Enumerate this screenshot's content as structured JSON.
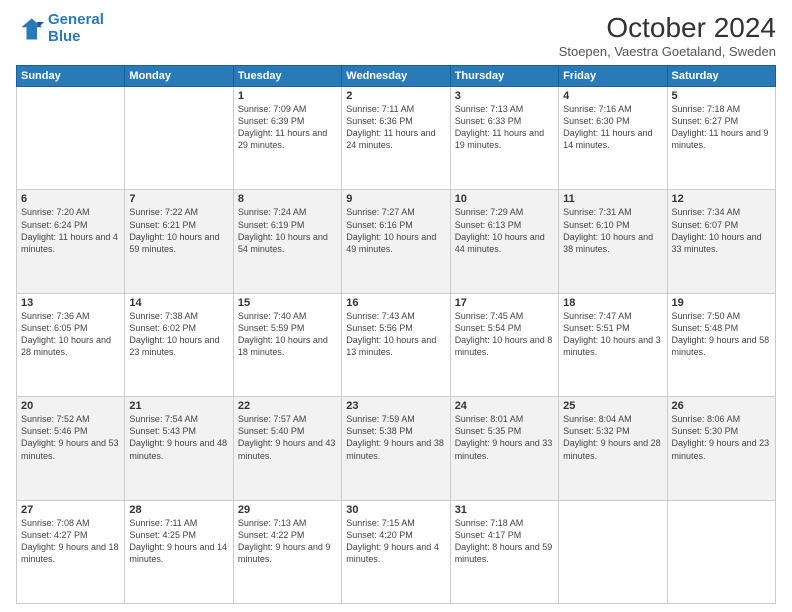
{
  "logo": {
    "line1": "General",
    "line2": "Blue"
  },
  "title": "October 2024",
  "location": "Stoepen, Vaestra Goetaland, Sweden",
  "days_header": [
    "Sunday",
    "Monday",
    "Tuesday",
    "Wednesday",
    "Thursday",
    "Friday",
    "Saturday"
  ],
  "weeks": [
    [
      {
        "day": "",
        "info": ""
      },
      {
        "day": "",
        "info": ""
      },
      {
        "day": "1",
        "info": "Sunrise: 7:09 AM\nSunset: 6:39 PM\nDaylight: 11 hours and 29 minutes."
      },
      {
        "day": "2",
        "info": "Sunrise: 7:11 AM\nSunset: 6:36 PM\nDaylight: 11 hours and 24 minutes."
      },
      {
        "day": "3",
        "info": "Sunrise: 7:13 AM\nSunset: 6:33 PM\nDaylight: 11 hours and 19 minutes."
      },
      {
        "day": "4",
        "info": "Sunrise: 7:16 AM\nSunset: 6:30 PM\nDaylight: 11 hours and 14 minutes."
      },
      {
        "day": "5",
        "info": "Sunrise: 7:18 AM\nSunset: 6:27 PM\nDaylight: 11 hours and 9 minutes."
      }
    ],
    [
      {
        "day": "6",
        "info": "Sunrise: 7:20 AM\nSunset: 6:24 PM\nDaylight: 11 hours and 4 minutes."
      },
      {
        "day": "7",
        "info": "Sunrise: 7:22 AM\nSunset: 6:21 PM\nDaylight: 10 hours and 59 minutes."
      },
      {
        "day": "8",
        "info": "Sunrise: 7:24 AM\nSunset: 6:19 PM\nDaylight: 10 hours and 54 minutes."
      },
      {
        "day": "9",
        "info": "Sunrise: 7:27 AM\nSunset: 6:16 PM\nDaylight: 10 hours and 49 minutes."
      },
      {
        "day": "10",
        "info": "Sunrise: 7:29 AM\nSunset: 6:13 PM\nDaylight: 10 hours and 44 minutes."
      },
      {
        "day": "11",
        "info": "Sunrise: 7:31 AM\nSunset: 6:10 PM\nDaylight: 10 hours and 38 minutes."
      },
      {
        "day": "12",
        "info": "Sunrise: 7:34 AM\nSunset: 6:07 PM\nDaylight: 10 hours and 33 minutes."
      }
    ],
    [
      {
        "day": "13",
        "info": "Sunrise: 7:36 AM\nSunset: 6:05 PM\nDaylight: 10 hours and 28 minutes."
      },
      {
        "day": "14",
        "info": "Sunrise: 7:38 AM\nSunset: 6:02 PM\nDaylight: 10 hours and 23 minutes."
      },
      {
        "day": "15",
        "info": "Sunrise: 7:40 AM\nSunset: 5:59 PM\nDaylight: 10 hours and 18 minutes."
      },
      {
        "day": "16",
        "info": "Sunrise: 7:43 AM\nSunset: 5:56 PM\nDaylight: 10 hours and 13 minutes."
      },
      {
        "day": "17",
        "info": "Sunrise: 7:45 AM\nSunset: 5:54 PM\nDaylight: 10 hours and 8 minutes."
      },
      {
        "day": "18",
        "info": "Sunrise: 7:47 AM\nSunset: 5:51 PM\nDaylight: 10 hours and 3 minutes."
      },
      {
        "day": "19",
        "info": "Sunrise: 7:50 AM\nSunset: 5:48 PM\nDaylight: 9 hours and 58 minutes."
      }
    ],
    [
      {
        "day": "20",
        "info": "Sunrise: 7:52 AM\nSunset: 5:46 PM\nDaylight: 9 hours and 53 minutes."
      },
      {
        "day": "21",
        "info": "Sunrise: 7:54 AM\nSunset: 5:43 PM\nDaylight: 9 hours and 48 minutes."
      },
      {
        "day": "22",
        "info": "Sunrise: 7:57 AM\nSunset: 5:40 PM\nDaylight: 9 hours and 43 minutes."
      },
      {
        "day": "23",
        "info": "Sunrise: 7:59 AM\nSunset: 5:38 PM\nDaylight: 9 hours and 38 minutes."
      },
      {
        "day": "24",
        "info": "Sunrise: 8:01 AM\nSunset: 5:35 PM\nDaylight: 9 hours and 33 minutes."
      },
      {
        "day": "25",
        "info": "Sunrise: 8:04 AM\nSunset: 5:32 PM\nDaylight: 9 hours and 28 minutes."
      },
      {
        "day": "26",
        "info": "Sunrise: 8:06 AM\nSunset: 5:30 PM\nDaylight: 9 hours and 23 minutes."
      }
    ],
    [
      {
        "day": "27",
        "info": "Sunrise: 7:08 AM\nSunset: 4:27 PM\nDaylight: 9 hours and 18 minutes."
      },
      {
        "day": "28",
        "info": "Sunrise: 7:11 AM\nSunset: 4:25 PM\nDaylight: 9 hours and 14 minutes."
      },
      {
        "day": "29",
        "info": "Sunrise: 7:13 AM\nSunset: 4:22 PM\nDaylight: 9 hours and 9 minutes."
      },
      {
        "day": "30",
        "info": "Sunrise: 7:15 AM\nSunset: 4:20 PM\nDaylight: 9 hours and 4 minutes."
      },
      {
        "day": "31",
        "info": "Sunrise: 7:18 AM\nSunset: 4:17 PM\nDaylight: 8 hours and 59 minutes."
      },
      {
        "day": "",
        "info": ""
      },
      {
        "day": "",
        "info": ""
      }
    ]
  ]
}
